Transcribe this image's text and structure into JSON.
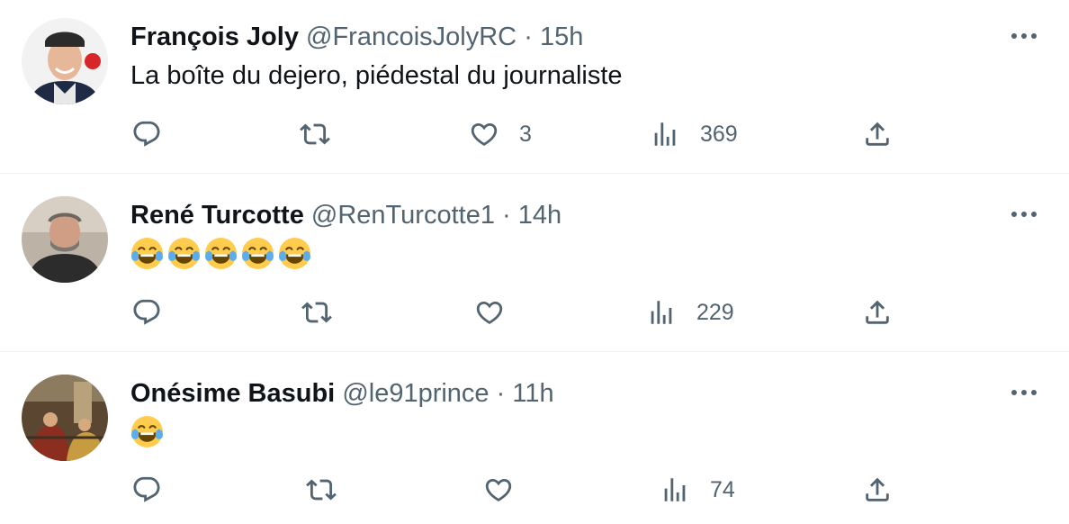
{
  "tweets": [
    {
      "name": "François Joly",
      "handle": "@FrancoisJolyRC",
      "separator": "·",
      "time": "15h",
      "text": "La boîte du dejero, piédestal du journaliste",
      "likes": "3",
      "views": "369"
    },
    {
      "name": "René Turcotte",
      "handle": "@RenTurcotte1",
      "separator": "·",
      "time": "14h",
      "emoji": [
        "face-with-tears-of-joy",
        "face-with-tears-of-joy",
        "face-with-tears-of-joy",
        "face-with-tears-of-joy",
        "face-with-tears-of-joy"
      ],
      "likes": "",
      "views": "229"
    },
    {
      "name": "Onésime Basubi",
      "handle": "@le91prince",
      "separator": "·",
      "time": "11h",
      "emoji": [
        "face-with-tears-of-joy"
      ],
      "likes": "",
      "views": "74"
    }
  ],
  "icons": {
    "reply": "reply-icon",
    "retweet": "retweet-icon",
    "like": "heart-icon",
    "views": "views-icon",
    "share": "share-icon",
    "more": "more-icon"
  },
  "colors": {
    "text": "#0f1419",
    "muted": "#536471",
    "separator": "#eff3f4",
    "emoji": "#ffcc4d",
    "tears": "#5dadec"
  }
}
